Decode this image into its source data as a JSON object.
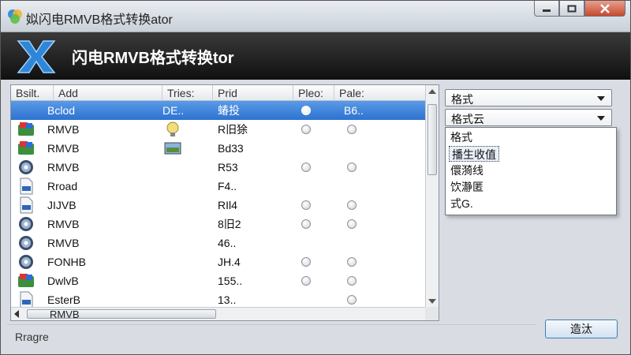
{
  "window": {
    "title": "姒闪电RMVB格式转换ator"
  },
  "banner": {
    "title": "闪电RMVB格式转换tor",
    "logo_icon": "x-logo-icon"
  },
  "list": {
    "columns": [
      "Bsilt.",
      "Add",
      "Tries:",
      "Prid",
      "Pleo:",
      "Pale:"
    ],
    "rows": [
      {
        "name": "Bclod",
        "tries": "DE..",
        "prid": "蝽投",
        "pleo": "filled",
        "pale": "B6..",
        "icon": "none",
        "selected": true
      },
      {
        "name": "RMVB",
        "tries": "",
        "prid": "R旧狳",
        "pleo": "radio",
        "pale": "radio",
        "icon": "video-icon",
        "tries_icon": "lightbulb-icon"
      },
      {
        "name": "RMVB",
        "tries": "",
        "prid": "Bd33",
        "pleo": "",
        "pale": "",
        "icon": "video-icon",
        "tries_icon": "image-icon"
      },
      {
        "name": "RMVB",
        "tries": "",
        "prid": "R53",
        "pleo": "radio",
        "pale": "radio",
        "icon": "disc-icon"
      },
      {
        "name": "Rroad",
        "tries": "",
        "prid": "F4..",
        "pleo": "",
        "pale": "",
        "icon": "document-icon"
      },
      {
        "name": "JIJVB",
        "tries": "",
        "prid": "RIl4",
        "pleo": "radio",
        "pale": "radio",
        "icon": "document-icon"
      },
      {
        "name": "RMVB",
        "tries": "",
        "prid": "8旧2",
        "pleo": "radio",
        "pale": "radio",
        "icon": "disc-icon"
      },
      {
        "name": "RMVB",
        "tries": "",
        "prid": "46..",
        "pleo": "",
        "pale": "",
        "icon": "disc-icon"
      },
      {
        "name": "FONHB",
        "tries": "",
        "prid": "JH.4",
        "pleo": "radio",
        "pale": "radio",
        "icon": "disc-icon"
      },
      {
        "name": "DwlvB",
        "tries": "",
        "prid": "155..",
        "pleo": "radio",
        "pale": "radio",
        "icon": "video-icon"
      },
      {
        "name": "EsterB",
        "tries": "",
        "prid": "13..",
        "pleo": "",
        "pale": "radio",
        "icon": "document-icon"
      }
    ],
    "hscroll_label": "RMVB"
  },
  "right": {
    "combo1": "格式",
    "combo2": "格式云",
    "dropdown_items": [
      "格式",
      "播生收值",
      "儇漪线",
      "饮瀞匿",
      "式G."
    ],
    "hover_index": 1
  },
  "status": {
    "text": "Rragre"
  },
  "action_button": {
    "label": "造汰"
  },
  "colors": {
    "selection": "#2d72d0",
    "banner": "#101010",
    "close_button": "#c64a2e"
  }
}
